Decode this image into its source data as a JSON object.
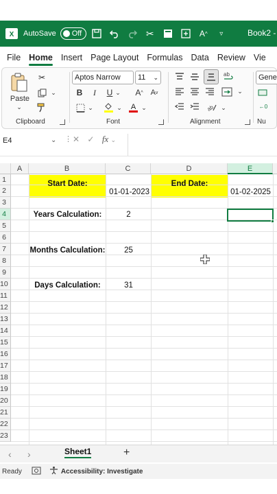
{
  "titlebar": {
    "autosave_label": "AutoSave",
    "autosave_state": "Off",
    "book_name": "Book2 -"
  },
  "tabs": [
    "File",
    "Home",
    "Insert",
    "Page Layout",
    "Formulas",
    "Data",
    "Review",
    "Vie"
  ],
  "ribbon": {
    "clipboard_label": "Clipboard",
    "paste_label": "Paste",
    "font_name": "Aptos Narrow",
    "font_size": "11",
    "font_label": "Font",
    "alignment_label": "Alignment",
    "number_format": "Genera",
    "number_label": "Nu"
  },
  "formula_bar": {
    "name_box": "E4",
    "fx": "fx"
  },
  "columns": [
    "A",
    "B",
    "C",
    "D",
    "E"
  ],
  "rows": [
    "1",
    "2",
    "3",
    "4",
    "5",
    "6",
    "7",
    "8",
    "9",
    "10",
    "11",
    "12",
    "13",
    "14",
    "15",
    "16",
    "17",
    "18",
    "19",
    "20",
    "21",
    "22",
    "23"
  ],
  "cells": {
    "b2": "Start Date:",
    "c2": "01-01-2023",
    "d2": "End Date:",
    "e2": "01-02-2025",
    "b4": "Years Calculation:",
    "c4": "2",
    "b7": "Months Calculation:",
    "c7": "25",
    "b10": "Days Calculation:",
    "c10": "31"
  },
  "sheet_tab": "Sheet1",
  "status": {
    "ready": "Ready",
    "accessibility": "Accessibility: Investigate"
  },
  "colors": {
    "excel_green": "#107c41",
    "highlight_yellow": "#ffff00"
  }
}
